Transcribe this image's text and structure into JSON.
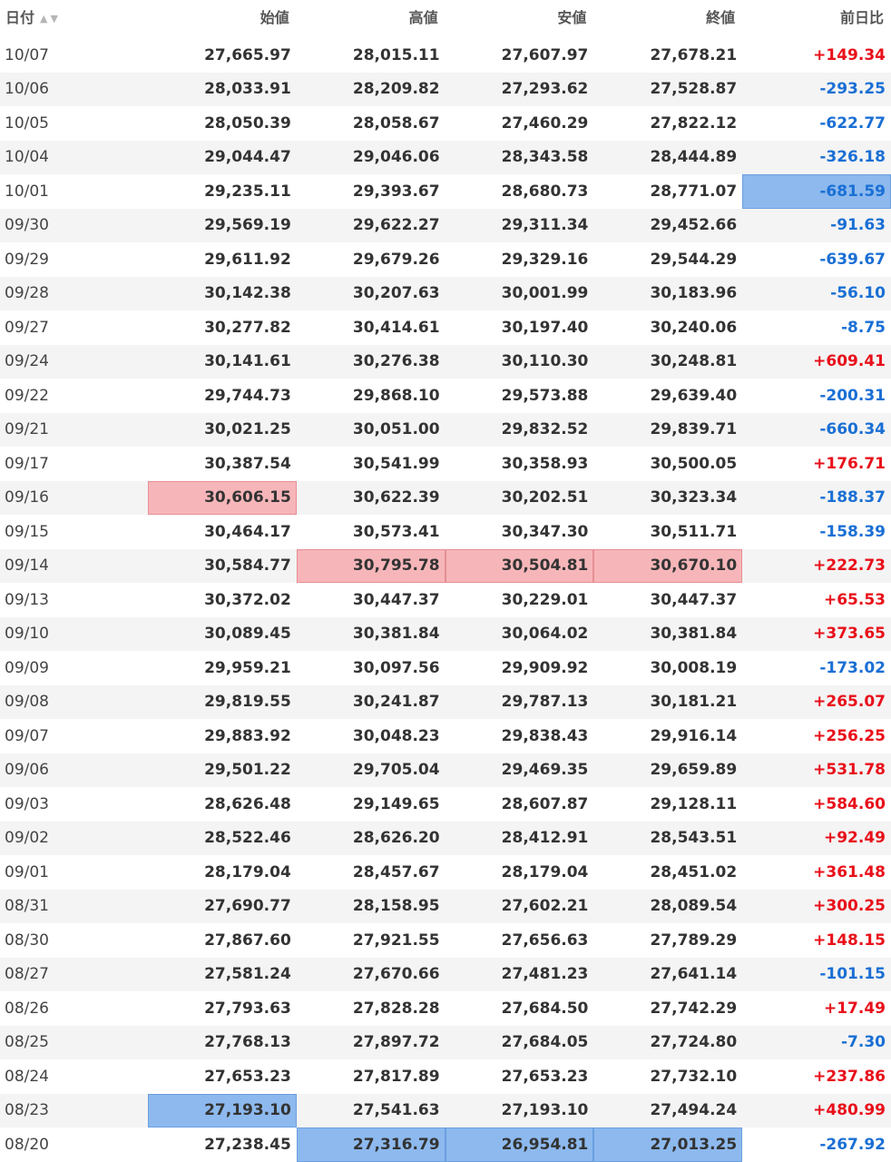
{
  "headers": [
    "日付",
    "始値",
    "高値",
    "安値",
    "終値",
    "前日比"
  ],
  "sort_icons": "▲▼",
  "colors": {
    "positive": "#e8101a",
    "negative": "#1a6fd4",
    "highlight_high": "#f6b6b9",
    "highlight_low": "#8db9ee"
  },
  "rows": [
    {
      "date": "10/07",
      "open": "27,665.97",
      "high": "28,015.11",
      "low": "27,607.97",
      "close": "27,678.21",
      "change": "+149.34"
    },
    {
      "date": "10/06",
      "open": "28,033.91",
      "high": "28,209.82",
      "low": "27,293.62",
      "close": "27,528.87",
      "change": "-293.25"
    },
    {
      "date": "10/05",
      "open": "28,050.39",
      "high": "28,058.67",
      "low": "27,460.29",
      "close": "27,822.12",
      "change": "-622.77"
    },
    {
      "date": "10/04",
      "open": "29,044.47",
      "high": "29,046.06",
      "low": "28,343.58",
      "close": "28,444.89",
      "change": "-326.18"
    },
    {
      "date": "10/01",
      "open": "29,235.11",
      "high": "29,393.67",
      "low": "28,680.73",
      "close": "28,771.07",
      "change": "-681.59",
      "hl": {
        "change": "blue"
      }
    },
    {
      "date": "09/30",
      "open": "29,569.19",
      "high": "29,622.27",
      "low": "29,311.34",
      "close": "29,452.66",
      "change": "-91.63"
    },
    {
      "date": "09/29",
      "open": "29,611.92",
      "high": "29,679.26",
      "low": "29,329.16",
      "close": "29,544.29",
      "change": "-639.67"
    },
    {
      "date": "09/28",
      "open": "30,142.38",
      "high": "30,207.63",
      "low": "30,001.99",
      "close": "30,183.96",
      "change": "-56.10"
    },
    {
      "date": "09/27",
      "open": "30,277.82",
      "high": "30,414.61",
      "low": "30,197.40",
      "close": "30,240.06",
      "change": "-8.75"
    },
    {
      "date": "09/24",
      "open": "30,141.61",
      "high": "30,276.38",
      "low": "30,110.30",
      "close": "30,248.81",
      "change": "+609.41"
    },
    {
      "date": "09/22",
      "open": "29,744.73",
      "high": "29,868.10",
      "low": "29,573.88",
      "close": "29,639.40",
      "change": "-200.31"
    },
    {
      "date": "09/21",
      "open": "30,021.25",
      "high": "30,051.00",
      "low": "29,832.52",
      "close": "29,839.71",
      "change": "-660.34"
    },
    {
      "date": "09/17",
      "open": "30,387.54",
      "high": "30,541.99",
      "low": "30,358.93",
      "close": "30,500.05",
      "change": "+176.71"
    },
    {
      "date": "09/16",
      "open": "30,606.15",
      "high": "30,622.39",
      "low": "30,202.51",
      "close": "30,323.34",
      "change": "-188.37",
      "hl": {
        "open": "red"
      }
    },
    {
      "date": "09/15",
      "open": "30,464.17",
      "high": "30,573.41",
      "low": "30,347.30",
      "close": "30,511.71",
      "change": "-158.39"
    },
    {
      "date": "09/14",
      "open": "30,584.77",
      "high": "30,795.78",
      "low": "30,504.81",
      "close": "30,670.10",
      "change": "+222.73",
      "hl": {
        "high": "red",
        "low": "red",
        "close": "red"
      }
    },
    {
      "date": "09/13",
      "open": "30,372.02",
      "high": "30,447.37",
      "low": "30,229.01",
      "close": "30,447.37",
      "change": "+65.53"
    },
    {
      "date": "09/10",
      "open": "30,089.45",
      "high": "30,381.84",
      "low": "30,064.02",
      "close": "30,381.84",
      "change": "+373.65"
    },
    {
      "date": "09/09",
      "open": "29,959.21",
      "high": "30,097.56",
      "low": "29,909.92",
      "close": "30,008.19",
      "change": "-173.02"
    },
    {
      "date": "09/08",
      "open": "29,819.55",
      "high": "30,241.87",
      "low": "29,787.13",
      "close": "30,181.21",
      "change": "+265.07"
    },
    {
      "date": "09/07",
      "open": "29,883.92",
      "high": "30,048.23",
      "low": "29,838.43",
      "close": "29,916.14",
      "change": "+256.25"
    },
    {
      "date": "09/06",
      "open": "29,501.22",
      "high": "29,705.04",
      "low": "29,469.35",
      "close": "29,659.89",
      "change": "+531.78"
    },
    {
      "date": "09/03",
      "open": "28,626.48",
      "high": "29,149.65",
      "low": "28,607.87",
      "close": "29,128.11",
      "change": "+584.60"
    },
    {
      "date": "09/02",
      "open": "28,522.46",
      "high": "28,626.20",
      "low": "28,412.91",
      "close": "28,543.51",
      "change": "+92.49"
    },
    {
      "date": "09/01",
      "open": "28,179.04",
      "high": "28,457.67",
      "low": "28,179.04",
      "close": "28,451.02",
      "change": "+361.48"
    },
    {
      "date": "08/31",
      "open": "27,690.77",
      "high": "28,158.95",
      "low": "27,602.21",
      "close": "28,089.54",
      "change": "+300.25"
    },
    {
      "date": "08/30",
      "open": "27,867.60",
      "high": "27,921.55",
      "low": "27,656.63",
      "close": "27,789.29",
      "change": "+148.15"
    },
    {
      "date": "08/27",
      "open": "27,581.24",
      "high": "27,670.66",
      "low": "27,481.23",
      "close": "27,641.14",
      "change": "-101.15"
    },
    {
      "date": "08/26",
      "open": "27,793.63",
      "high": "27,828.28",
      "low": "27,684.50",
      "close": "27,742.29",
      "change": "+17.49"
    },
    {
      "date": "08/25",
      "open": "27,768.13",
      "high": "27,897.72",
      "low": "27,684.05",
      "close": "27,724.80",
      "change": "-7.30"
    },
    {
      "date": "08/24",
      "open": "27,653.23",
      "high": "27,817.89",
      "low": "27,653.23",
      "close": "27,732.10",
      "change": "+237.86"
    },
    {
      "date": "08/23",
      "open": "27,193.10",
      "high": "27,541.63",
      "low": "27,193.10",
      "close": "27,494.24",
      "change": "+480.99",
      "hl": {
        "open": "blue"
      }
    },
    {
      "date": "08/20",
      "open": "27,238.45",
      "high": "27,316.79",
      "low": "26,954.81",
      "close": "27,013.25",
      "change": "-267.92",
      "hl": {
        "high": "blue",
        "low": "blue",
        "close": "blue"
      }
    }
  ]
}
